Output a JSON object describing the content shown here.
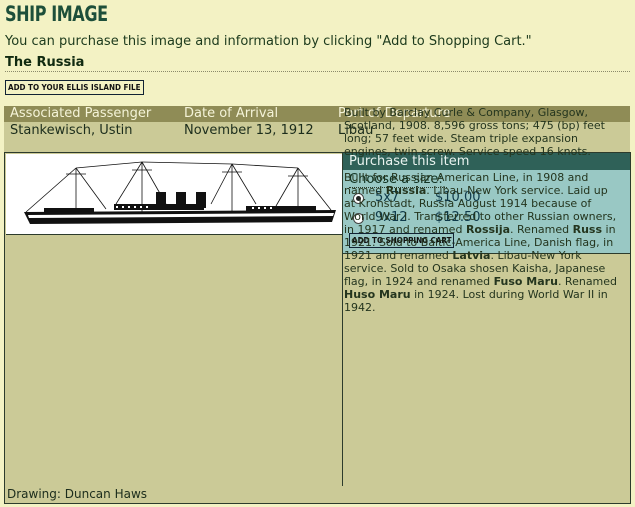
{
  "page": {
    "title": "SHIP IMAGE",
    "intro": "You can purchase this image and information by clicking \"Add to Shopping Cart.\"",
    "ship_name": "The Russia",
    "ellis_button": "ADD TO YOUR ELLIS ISLAND FILE"
  },
  "passenger": {
    "headers": [
      "Associated Passenger",
      "Date of Arrival",
      "Port of Departure"
    ],
    "values": [
      "Stankewisch, Ustin",
      "November 13, 1912",
      "Libau"
    ]
  },
  "purchase": {
    "heading": "Purchase this item",
    "size_label": "Choose a size:",
    "options": [
      {
        "size": "5x7",
        "price": "$10.00",
        "selected": true
      },
      {
        "size": "9x12",
        "price": "$12.50",
        "selected": false
      }
    ],
    "cart_button": "ADD TO SHOPPING CART"
  },
  "description": {
    "p1": "Built by Barclay Curle & Company, Glasgow, Scotland, 1908. 8,596 gross tons; 475 (bp) feet long; 57 feet wide. Steam triple expansion engines, twin screw.  Service speed 16 knots.",
    "p2_parts": [
      {
        "t": "Built for Russian American Line, in 1908 and named ",
        "b": false
      },
      {
        "t": "Russia",
        "b": true
      },
      {
        "t": ". Libau-New York service. Laid up at Kronstadt, Russia August 1914 because of World War I. Transferred to other Russian owners, in 1917 and renamed ",
        "b": false
      },
      {
        "t": "Rossija",
        "b": true
      },
      {
        "t": ". Renamed ",
        "b": false
      },
      {
        "t": "Russ",
        "b": true
      },
      {
        "t": " in 1921. Sold to Baltic-America Line, Danish flag, in 1921 and renamed ",
        "b": false
      },
      {
        "t": "Latvia",
        "b": true
      },
      {
        "t": ". Libau-New York service. Sold to Osaka shosen Kaisha, Japanese flag, in 1924 and renamed ",
        "b": false
      },
      {
        "t": "Fuso Maru",
        "b": true
      },
      {
        "t": ". Renamed ",
        "b": false
      },
      {
        "t": "Huso Maru",
        "b": true
      },
      {
        "t": " in 1924. Lost during World War II in 1942.",
        "b": false
      }
    ]
  },
  "credit": "Drawing: Duncan Haws",
  "icons": {
    "ship": "ship-drawing-icon"
  },
  "colors": {
    "background": "#f3f2c4",
    "table_bg": "#cbca97",
    "header_bg": "#8f8c56",
    "purchase_bg": "#99c8c4",
    "purchase_head": "#2f6158",
    "title": "#1d4f3a"
  }
}
